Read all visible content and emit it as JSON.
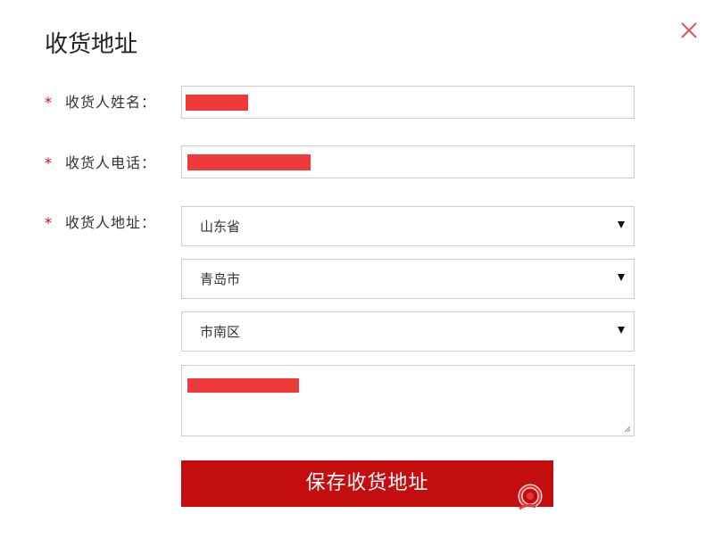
{
  "dialog": {
    "title": "收货地址",
    "close_icon": "close-icon"
  },
  "form": {
    "required_mark": "*",
    "name": {
      "label": "收货人姓名："
    },
    "phone": {
      "label": "收货人电话："
    },
    "address": {
      "label": "收货人地址：",
      "province": "山东省",
      "city": "青岛市",
      "district": "市南区"
    },
    "save_label": "保存收货地址"
  },
  "colors": {
    "accent": "#c30d0f",
    "required": "#e60012",
    "redaction": "#f03a3a",
    "border": "#cccccc"
  }
}
